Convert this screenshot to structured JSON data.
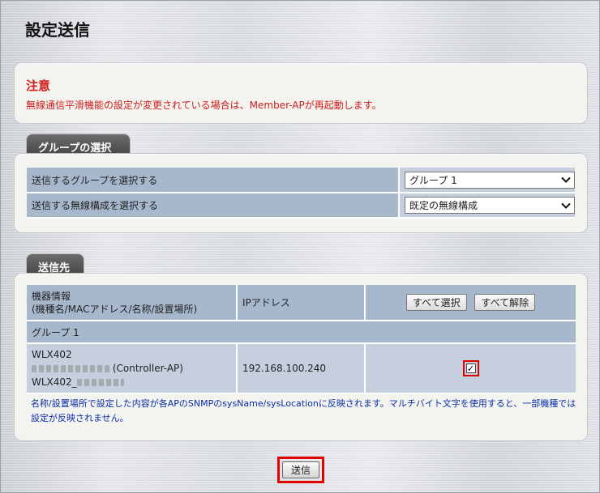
{
  "page": {
    "title": "設定送信"
  },
  "notice": {
    "title": "注意",
    "text": "無線通信平滑機能の設定が変更されている場合は、Member-APが再起動します。"
  },
  "group_section": {
    "tab_label": "グループの選択",
    "rows": [
      {
        "label": "送信するグループを選択する",
        "selected": "グループ 1"
      },
      {
        "label": "送信する無線構成を選択する",
        "selected": "既定の無線構成"
      }
    ]
  },
  "dest_section": {
    "tab_label": "送信先",
    "header": {
      "device_info_line1": "機器情報",
      "device_info_line2": "(機種名/MACアドレス/名称/設置場所)",
      "ip_label": "IPアドレス",
      "select_all": "すべて選択",
      "deselect_all": "すべて解除"
    },
    "group_name": "グループ 1",
    "devices": [
      {
        "model": "WLX402",
        "role": "(Controller-AP)",
        "name_prefix": "WLX402_",
        "ip": "192.168.100.240",
        "checked": true
      }
    ],
    "note": "名称/設置場所で設定した内容が各APのSNMPのsysName/sysLocationに反映されます。マルチバイト文字を使用すると、一部機種では設定が反映されません。"
  },
  "send_button": "送信",
  "colors": {
    "accent_red": "#d01c1c",
    "note_blue": "#0b2ea8",
    "header_cell": "#a7b8cd",
    "value_cell": "#c5cfdd"
  }
}
